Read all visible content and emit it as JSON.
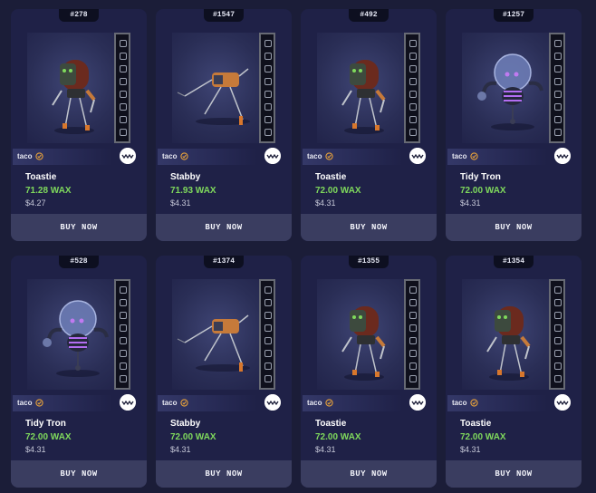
{
  "buy_label": "BUY NOW",
  "colors": {
    "accent_green": "#7fd95c",
    "card_bg": "#1f2147",
    "page_bg": "#1b1d38"
  },
  "cards": [
    {
      "mint": "#278",
      "collection": "taco",
      "name": "Toastie",
      "price": "71.28 WAX",
      "usd": "$4.27",
      "robot": "toastie"
    },
    {
      "mint": "#1547",
      "collection": "taco",
      "name": "Stabby",
      "price": "71.93 WAX",
      "usd": "$4.31",
      "robot": "stabby"
    },
    {
      "mint": "#492",
      "collection": "taco",
      "name": "Toastie",
      "price": "72.00 WAX",
      "usd": "$4.31",
      "robot": "toastie"
    },
    {
      "mint": "#1257",
      "collection": "taco",
      "name": "Tidy Tron",
      "price": "72.00 WAX",
      "usd": "$4.31",
      "robot": "tidytron"
    },
    {
      "mint": "#528",
      "collection": "taco",
      "name": "Tidy Tron",
      "price": "72.00 WAX",
      "usd": "$4.31",
      "robot": "tidytron"
    },
    {
      "mint": "#1374",
      "collection": "taco",
      "name": "Stabby",
      "price": "72.00 WAX",
      "usd": "$4.31",
      "robot": "stabby"
    },
    {
      "mint": "#1355",
      "collection": "taco",
      "name": "Toastie",
      "price": "72.00 WAX",
      "usd": "$4.31",
      "robot": "toastie"
    },
    {
      "mint": "#1354",
      "collection": "taco",
      "name": "Toastie",
      "price": "72.00 WAX",
      "usd": "$4.31",
      "robot": "toastie"
    }
  ]
}
